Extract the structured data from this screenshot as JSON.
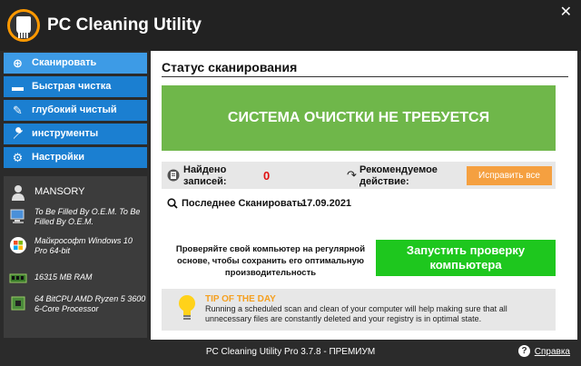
{
  "app": {
    "title": "PC Cleaning Utility",
    "close_glyph": "✕",
    "logo_icon": "broom-logo"
  },
  "sidebar": {
    "items": [
      {
        "label": "Сканировать",
        "icon": "scan-icon",
        "glyph": "⊕",
        "active": true
      },
      {
        "label": "Быстрая чистка",
        "icon": "quick-clean-icon",
        "glyph": "▬",
        "active": false
      },
      {
        "label": "глубокий чистый",
        "icon": "broom-icon",
        "glyph": "✎",
        "active": false
      },
      {
        "label": "инструменты",
        "icon": "wrench-icon",
        "glyph": "🔧",
        "active": false
      },
      {
        "label": "Настройки",
        "icon": "gear-icon",
        "glyph": "⚙",
        "active": false
      }
    ],
    "system": {
      "user": "MANSORY",
      "model": "To Be Filled By O.E.M. To Be Filled By O.E.M.",
      "os": "Майкрософт Windows 10 Pro 64-bit",
      "ram": "16315 MB RAM",
      "cpu": "64 BitCPU AMD Ryzen 5 3600 6-Core Processor"
    }
  },
  "main": {
    "section_title": "Статус сканирования",
    "banner": "СИСТЕМА ОЧИСТКИ НЕ ТРЕБУЕТСЯ",
    "found_label": "Найдено записей:",
    "found_value": "0",
    "recommended_label": "Рекомендуемое действие:",
    "fix_all": "Исправить все",
    "last_scan_label": "Последнее Сканировать:",
    "last_scan_date": "17.09.2021",
    "promo_text": "Проверяйте свой компьютер на регулярной основе, чтобы сохранить его оптимальную производительность",
    "scan_button": "Запустить проверку компьютера",
    "tip_title": "TIP OF THE DAY",
    "tip_text": "Running a scheduled scan and clean of your computer will help making sure that all unnecessary files are constantly deleted and your registry is in optimal state."
  },
  "footer": {
    "version": "PC Cleaning Utility Pro 3.7.8 - ПРЕМИУМ",
    "help": "Справка"
  },
  "colors": {
    "accent": "#1b7fd1",
    "banner": "#6fb74a",
    "scan_button": "#1ec71e",
    "fix_button": "#f5a040",
    "tip_title": "#f5a020"
  }
}
